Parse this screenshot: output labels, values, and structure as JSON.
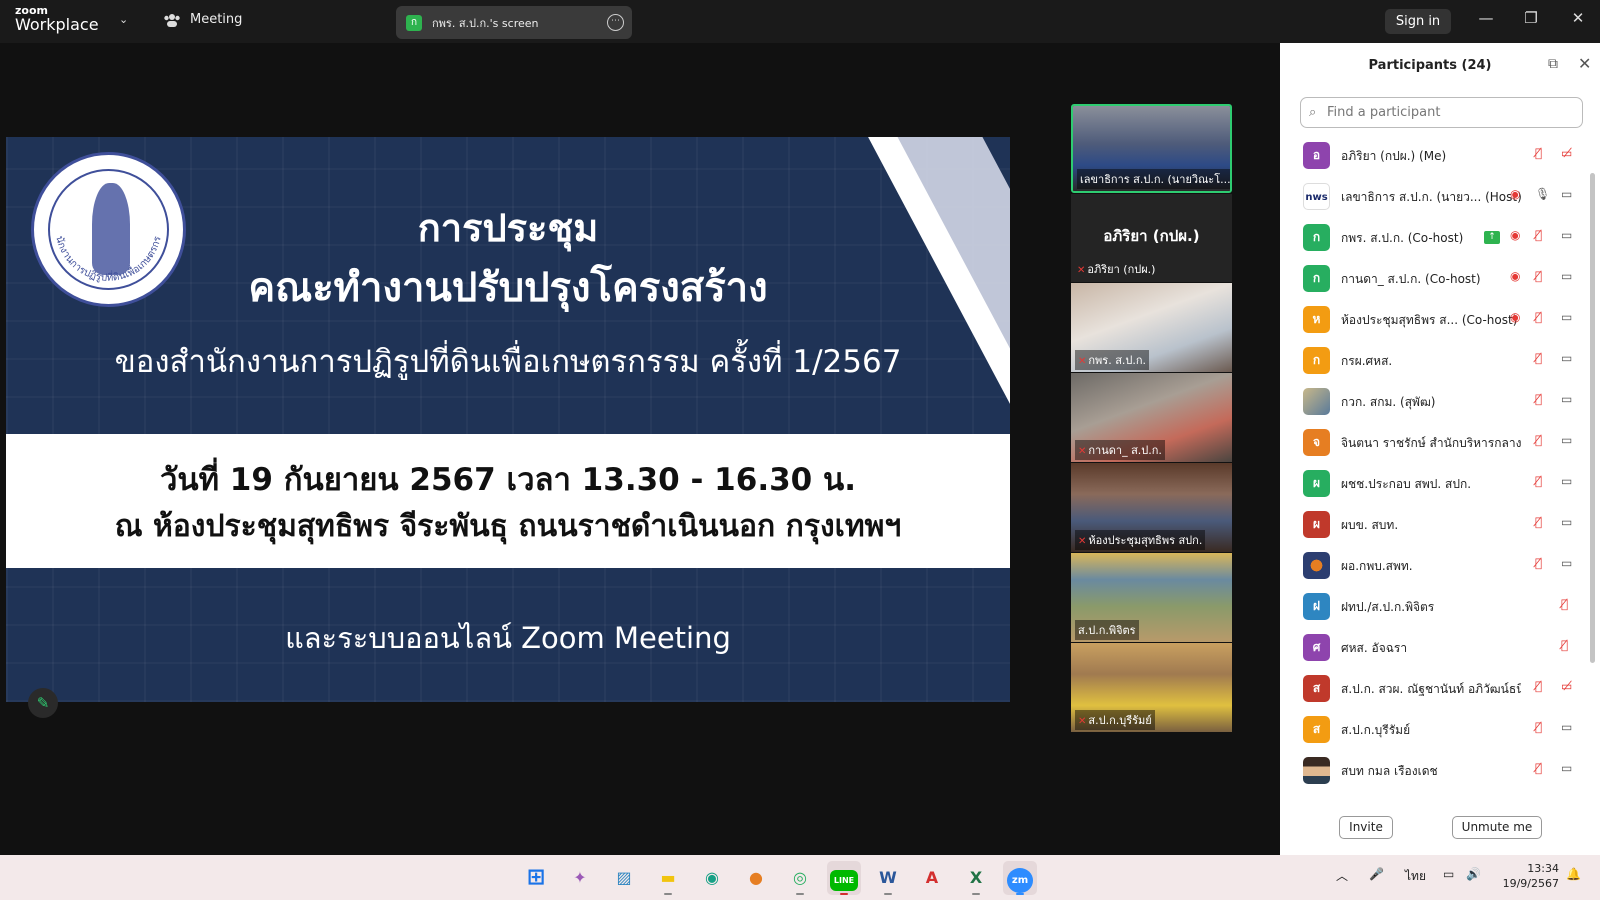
{
  "titlebar": {
    "brand_top": "zoom",
    "brand_bottom": "Workplace",
    "chevron": "⌄",
    "meeting_label": "Meeting",
    "share_badge": "ก",
    "share_title": "กพร. ส.ป.ก.'s screen",
    "share_menu": "⋯",
    "signin_label": "Sign in",
    "minimize": "—",
    "restore": "❐",
    "close": "✕"
  },
  "slide": {
    "title1": "การประชุม",
    "title2": "คณะทำงานปรับปรุงโครงสร้าง",
    "subtitle": "ของสำนักงานการปฏิรูปที่ดินเพื่อเกษตรกรรม ครั้งที่ 1/2567",
    "date_line": "วันที่ 19 กันยายน 2567 เวลา 13.30 - 16.30 น.",
    "place_line": "ณ ห้องประชุมสุทธิพร จีระพันธุ ถนนราชดำเนินนอก กรุงเทพฯ",
    "bottom_line": "และระบบออนไลน์ Zoom Meeting",
    "seal_text": "สำนักงานการปฏิรูปที่ดินเพื่อเกษตรกรรม"
  },
  "annotate_icon": "✎",
  "videos": {
    "active_label": "เลขาธิการ ส.ป.ก. (นายวิณะโ...",
    "self_name": "อภิริยา (กปผ.)",
    "self_label": "อภิริยา (กปผ.)",
    "thumbs": [
      {
        "label": "กพร. ส.ป.ก."
      },
      {
        "label": "กานดา_ ส.ป.ก."
      },
      {
        "label": "ห้องประชุมสุทธิพร สปก."
      },
      {
        "label": "ส.ป.ก.พิจิตร"
      },
      {
        "label": "ส.ป.ก.บุรีรัมย์"
      }
    ]
  },
  "panel": {
    "title": "Participants (24)",
    "popout_icon": "⧉",
    "close_icon": "✕",
    "search_placeholder": "Find a participant",
    "search_icon": "⌕",
    "invite_label": "Invite",
    "unmute_label": "Unmute me",
    "participants": [
      {
        "initial": "อ",
        "color": "#8e44ad",
        "name": "อภิริยา (กปผ.) (Me)",
        "video_off": true
      },
      {
        "initial": "nws",
        "color": "#ffffff",
        "name": "เลขาธิการ ส.ป.ก. (นายว... (Host)",
        "video_off": false
      },
      {
        "initial": "ก",
        "color": "#27ae60",
        "name": "กพร. ส.ป.ก. (Co-host)",
        "video_off": false
      },
      {
        "initial": "ก",
        "color": "#27ae60",
        "name": "กานดา_ ส.ป.ก. (Co-host)",
        "video_off": false
      },
      {
        "initial": "ห",
        "color": "#f39c12",
        "name": "ห้องประชุมสุทธิพร ส... (Co-host)",
        "video_off": false
      },
      {
        "initial": "ก",
        "color": "#f39c12",
        "name": "กรผ.ศหส.",
        "video_off": false
      },
      {
        "initial": "",
        "color": "#7a8a6a",
        "name": "กวก. สกม. (สุพัฒ)",
        "video_off": false
      },
      {
        "initial": "จ",
        "color": "#e67e22",
        "name": "จินตนา ราชรักษ์ สำนักบริหารกลาง",
        "video_off": false
      },
      {
        "initial": "ผ",
        "color": "#27ae60",
        "name": "ผชช.ประกอบ สพป. สปก.",
        "video_off": false
      },
      {
        "initial": "ผ",
        "color": "#c0392b",
        "name": "ผบข. สบท.",
        "video_off": false
      },
      {
        "initial": "",
        "color": "#2c3e70",
        "name": "ผอ.กพบ.สพท.",
        "video_off": false
      },
      {
        "initial": "ฝ",
        "color": "#2e86c1",
        "name": "ฝทป./ส.ป.ก.พิจิตร",
        "video_off": false
      },
      {
        "initial": "ศ",
        "color": "#8e44ad",
        "name": "ศหส. อัจฉรา",
        "video_off": false
      },
      {
        "initial": "ส",
        "color": "#c0392b",
        "name": "ส.ป.ก. สวผ. ณัฐชานันท์ อภิวัฒน์ธนิกุล",
        "video_off": true
      },
      {
        "initial": "ส",
        "color": "#f39c12",
        "name": "ส.ป.ก.บุรีรัมย์",
        "video_off": false
      },
      {
        "initial": "",
        "color": "#a07e66",
        "name": "สบท กมล เรืองเดช",
        "video_off": false
      }
    ]
  },
  "taskbar": {
    "icons": [
      {
        "name": "windows-start-icon",
        "glyph": "⊞",
        "color": "#1a73e8"
      },
      {
        "name": "copilot-icon",
        "glyph": "✦",
        "color": "#9b59b6"
      },
      {
        "name": "photos-icon",
        "glyph": "▨",
        "color": "#2e86c1"
      },
      {
        "name": "file-explorer-icon",
        "glyph": "▬",
        "color": "#f1c40f"
      },
      {
        "name": "edge-icon",
        "glyph": "◉",
        "color": "#16a085"
      },
      {
        "name": "firefox-icon",
        "glyph": "●",
        "color": "#e67e22"
      },
      {
        "name": "chrome-icon",
        "glyph": "◎",
        "color": "#27ae60"
      },
      {
        "name": "line-icon",
        "glyph": "LINE",
        "color": "#00b900"
      },
      {
        "name": "word-icon",
        "glyph": "W",
        "color": "#2b579a"
      },
      {
        "name": "acrobat-icon",
        "glyph": "A",
        "color": "#d32f2f"
      },
      {
        "name": "excel-icon",
        "glyph": "X",
        "color": "#217346"
      },
      {
        "name": "zoom-icon",
        "glyph": "zm",
        "color": "#2d8cff"
      }
    ],
    "tray_chevron": "︿",
    "mic_icon": "🎤",
    "language": "ไทย",
    "network_icon": "▭",
    "volume_icon": "🔊",
    "time": "13:34",
    "date": "19/9/2567",
    "bell_icon": "🔔"
  }
}
